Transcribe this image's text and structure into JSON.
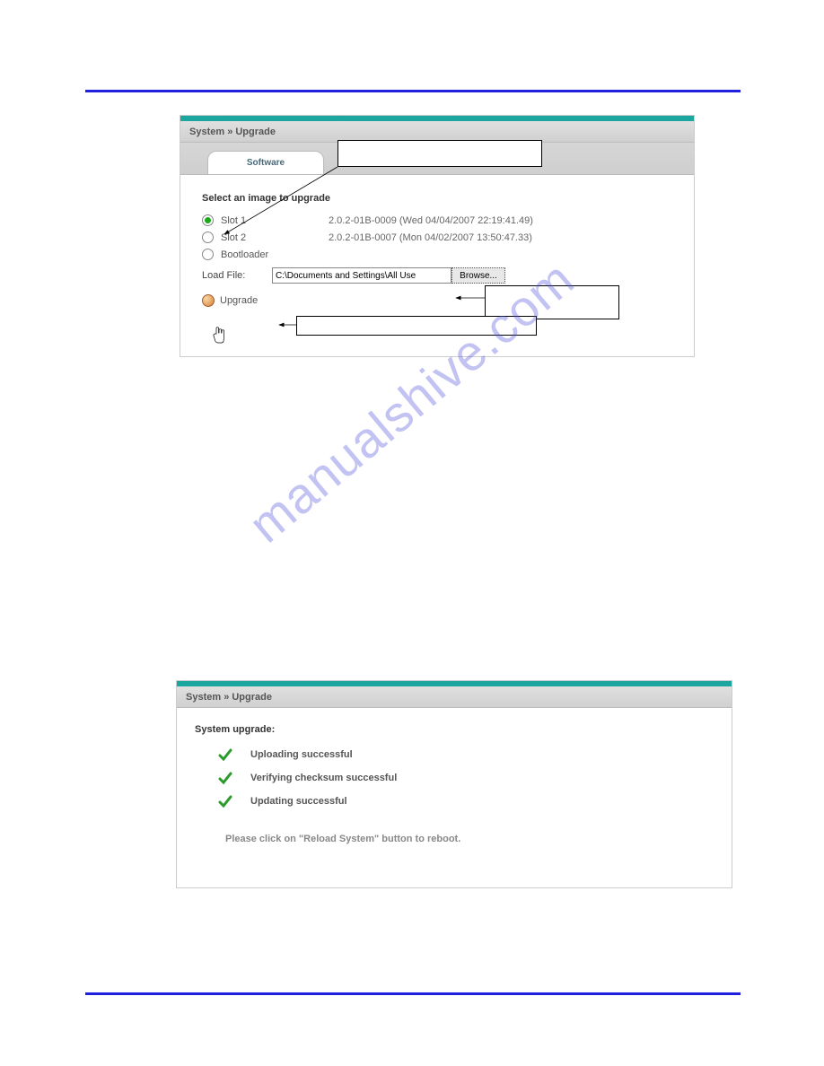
{
  "hrTop": 100,
  "hrBottom": 1106,
  "watermark": "manualshive.com",
  "panel1": {
    "breadcrumb": "System » Upgrade",
    "tab": "Software",
    "heading": "Select an image to upgrade",
    "slots": [
      {
        "label": "Slot 1",
        "version": "2.0.2-01B-0009 (Wed 04/04/2007 22:19:41.49)",
        "checked": true
      },
      {
        "label": "Slot 2",
        "version": "2.0.2-01B-0007 (Mon 04/02/2007 13:50:47.33)",
        "checked": false
      },
      {
        "label": "Bootloader",
        "version": "",
        "checked": false
      }
    ],
    "loadFileLabel": "Load File:",
    "loadFileValue": "C:\\Documents and Settings\\All Use",
    "browse": "Browse...",
    "upgrade": "Upgrade"
  },
  "panel2": {
    "breadcrumb": "System » Upgrade",
    "heading": "System upgrade:",
    "rows": [
      "Uploading successful",
      "Verifying checksum successful",
      "Updating successful"
    ],
    "reboot": "Please click on \"Reload System\" button to reboot."
  }
}
